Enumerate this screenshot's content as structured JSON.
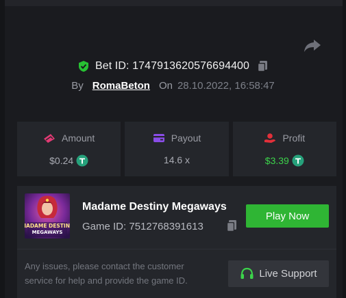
{
  "bet": {
    "label": "Bet ID: 1747913620576694400",
    "by_label": "By",
    "username": "RomaBeton",
    "on_label": "On",
    "date": "28.10.2022, 16:58:47"
  },
  "stats": {
    "amount": {
      "label": "Amount",
      "value": "$0.24",
      "icon": "amount-icon"
    },
    "payout": {
      "label": "Payout",
      "value": "14.6 x",
      "icon": "payout-icon"
    },
    "profit": {
      "label": "Profit",
      "value": "$3.39",
      "icon": "profit-icon"
    }
  },
  "game": {
    "name": "Madame Destiny Megaways",
    "id_label": "Game ID: 7512768391613",
    "play_label": "Play Now",
    "thumb_text": [
      "MADAME DESTINY",
      "MEGAWAYS"
    ]
  },
  "support": {
    "notice": "Any issues, please contact the customer service for help and provide the game ID.",
    "button_label": "Live Support"
  },
  "colors": {
    "accent_green": "#2fb534",
    "profit_green": "#3cd34b",
    "shield_green": "#27c233",
    "icon_pink": "#e23a74",
    "icon_purple": "#8a4de8",
    "icon_red": "#e2303a",
    "tether": "#26a17b"
  }
}
